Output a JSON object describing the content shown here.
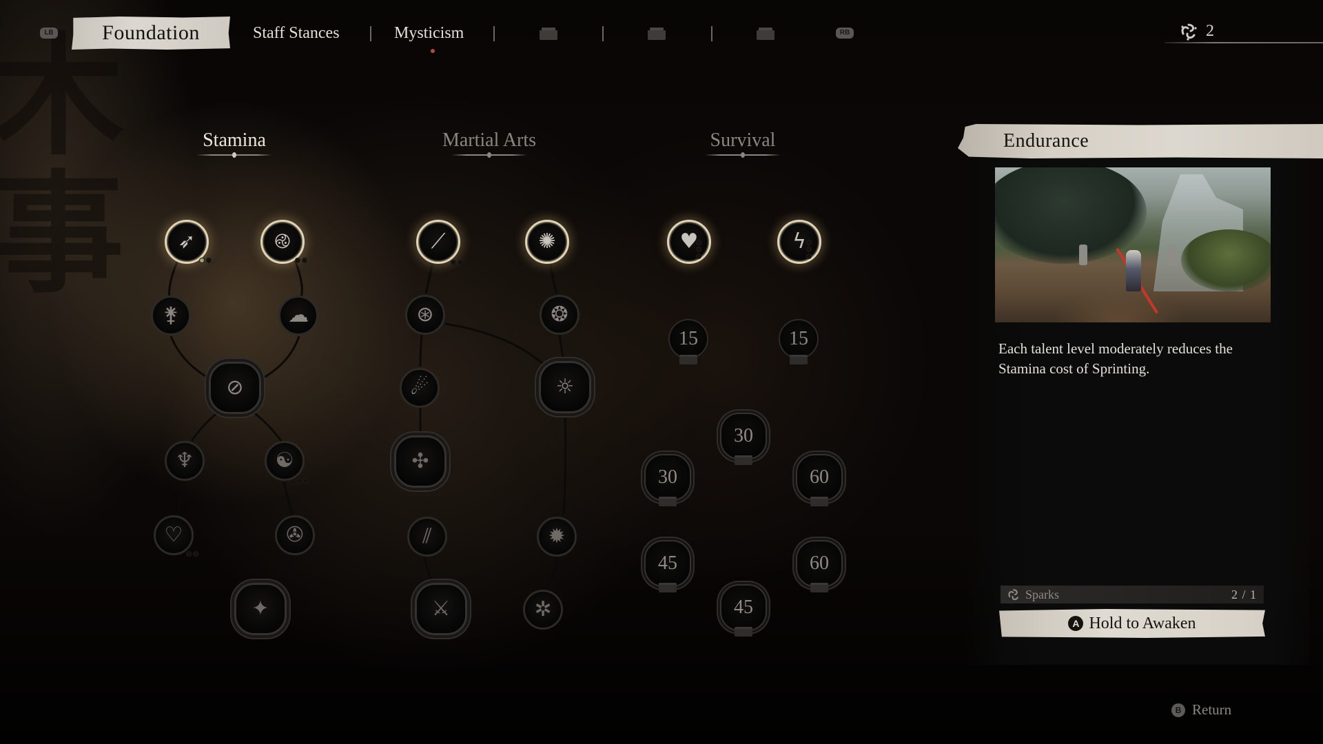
{
  "nav": {
    "left_bumper": "LB",
    "right_bumper": "RB",
    "tabs": [
      {
        "label": "Foundation",
        "state": "active"
      },
      {
        "label": "Staff Stances",
        "state": "available"
      },
      {
        "label": "Mysticism",
        "state": "available",
        "has_notification": true
      },
      {
        "label": "",
        "state": "locked",
        "icon": "locked-chest-icon"
      },
      {
        "label": "",
        "state": "locked",
        "icon": "locked-chest-icon"
      },
      {
        "label": "",
        "state": "locked",
        "icon": "locked-chest-icon"
      }
    ],
    "notification_color": "#b04b45"
  },
  "currency": {
    "icon": "spark-triskelion-icon",
    "amount": "2"
  },
  "categories": [
    {
      "label": "Stamina",
      "state": "active"
    },
    {
      "label": "Martial Arts",
      "state": "inactive"
    },
    {
      "label": "Survival",
      "state": "inactive"
    }
  ],
  "trees": {
    "stamina": {
      "nodes": [
        {
          "id": "s1",
          "icon": "sprint-wind-icon",
          "glyph": "➶",
          "state": "selected",
          "pips": [
            true,
            false
          ]
        },
        {
          "id": "s2",
          "icon": "swirl-spiral-icon",
          "glyph": "࿋",
          "state": "unlocked",
          "pips": [
            false,
            false
          ]
        },
        {
          "id": "s3",
          "icon": "dodge-figure-icon",
          "glyph": "⚵",
          "state": "available"
        },
        {
          "id": "s4",
          "icon": "cloud-swirl-icon",
          "glyph": "☁",
          "state": "available"
        },
        {
          "id": "s5",
          "icon": "staff-swirl-icon",
          "glyph": "⊘",
          "state": "available",
          "shape": "scalloped"
        },
        {
          "id": "s6",
          "icon": "gourd-drop-icon",
          "glyph": "♆",
          "state": "dim"
        },
        {
          "id": "s7",
          "icon": "monk-stance-icon",
          "glyph": "☯",
          "state": "dim",
          "pips": [
            false,
            false
          ]
        },
        {
          "id": "s8",
          "icon": "coiled-heart-icon",
          "glyph": "♡",
          "state": "dim",
          "pips": [
            false,
            false
          ]
        },
        {
          "id": "s9",
          "icon": "crouched-monkey-icon",
          "glyph": "✇",
          "state": "dim"
        },
        {
          "id": "s10",
          "icon": "lightning-leap-icon",
          "glyph": "✦",
          "state": "dim",
          "shape": "scalloped"
        }
      ]
    },
    "martial_arts": {
      "nodes": [
        {
          "id": "m1",
          "icon": "staff-strike-icon",
          "glyph": "⟋",
          "state": "unlocked",
          "pips": [
            false,
            false
          ]
        },
        {
          "id": "m2",
          "icon": "radial-burst-icon",
          "glyph": "✺",
          "state": "unlocked"
        },
        {
          "id": "m3",
          "icon": "staff-spin-icon",
          "glyph": "⊛",
          "state": "available"
        },
        {
          "id": "m4",
          "icon": "vortex-icon",
          "glyph": "❂",
          "state": "available"
        },
        {
          "id": "m5",
          "icon": "comet-staff-icon",
          "glyph": "☄",
          "state": "available"
        },
        {
          "id": "m6",
          "icon": "sun-spiral-icon",
          "glyph": "☼",
          "state": "available",
          "shape": "scalloped"
        },
        {
          "id": "m7",
          "icon": "pinwheel-staffs-icon",
          "glyph": "✣",
          "state": "dim",
          "shape": "scalloped"
        },
        {
          "id": "m8",
          "icon": "triple-slash-icon",
          "glyph": "⫽",
          "state": "dim"
        },
        {
          "id": "m9",
          "icon": "shatter-icon",
          "glyph": "✹",
          "state": "dim"
        },
        {
          "id": "m10",
          "icon": "crossed-staffs-icon",
          "glyph": "⚔",
          "state": "dim",
          "shape": "scalloped"
        },
        {
          "id": "m11",
          "icon": "hands-wheel-icon",
          "glyph": "✲",
          "state": "dim"
        }
      ]
    },
    "survival": {
      "nodes": [
        {
          "id": "v1",
          "icon": "heart-hands-icon",
          "glyph": "♥",
          "state": "unlocked",
          "pips": [
            false,
            false,
            false,
            false,
            false,
            false
          ]
        },
        {
          "id": "v2",
          "icon": "lightning-rune-icon",
          "glyph": "ϟ",
          "state": "unlocked",
          "pips": [
            false,
            false,
            false,
            false,
            false,
            false
          ]
        }
      ],
      "locked": [
        {
          "id": "l1",
          "requirement": "15"
        },
        {
          "id": "l2",
          "requirement": "15"
        },
        {
          "id": "l3",
          "requirement": "30",
          "shape": "scalloped"
        },
        {
          "id": "l4",
          "requirement": "30",
          "shape": "scalloped"
        },
        {
          "id": "l5",
          "requirement": "60",
          "shape": "scalloped"
        },
        {
          "id": "l6",
          "requirement": "45",
          "shape": "scalloped"
        },
        {
          "id": "l7",
          "requirement": "60",
          "shape": "scalloped"
        },
        {
          "id": "l8",
          "requirement": "45",
          "shape": "scalloped"
        }
      ]
    }
  },
  "detail": {
    "title": "Endurance",
    "preview_alt": "Destined One sprinting with staff through a forest shrine",
    "description": "Each talent level moderately reduces the Stamina cost of Sprinting.",
    "cost_label": "Sparks",
    "cost_icon": "spark-triskelion-icon",
    "cost_value": "2 / 1",
    "action_button": "A",
    "action_label": "Hold to Awaken"
  },
  "footer": {
    "return_button": "B",
    "return_label": "Return"
  }
}
